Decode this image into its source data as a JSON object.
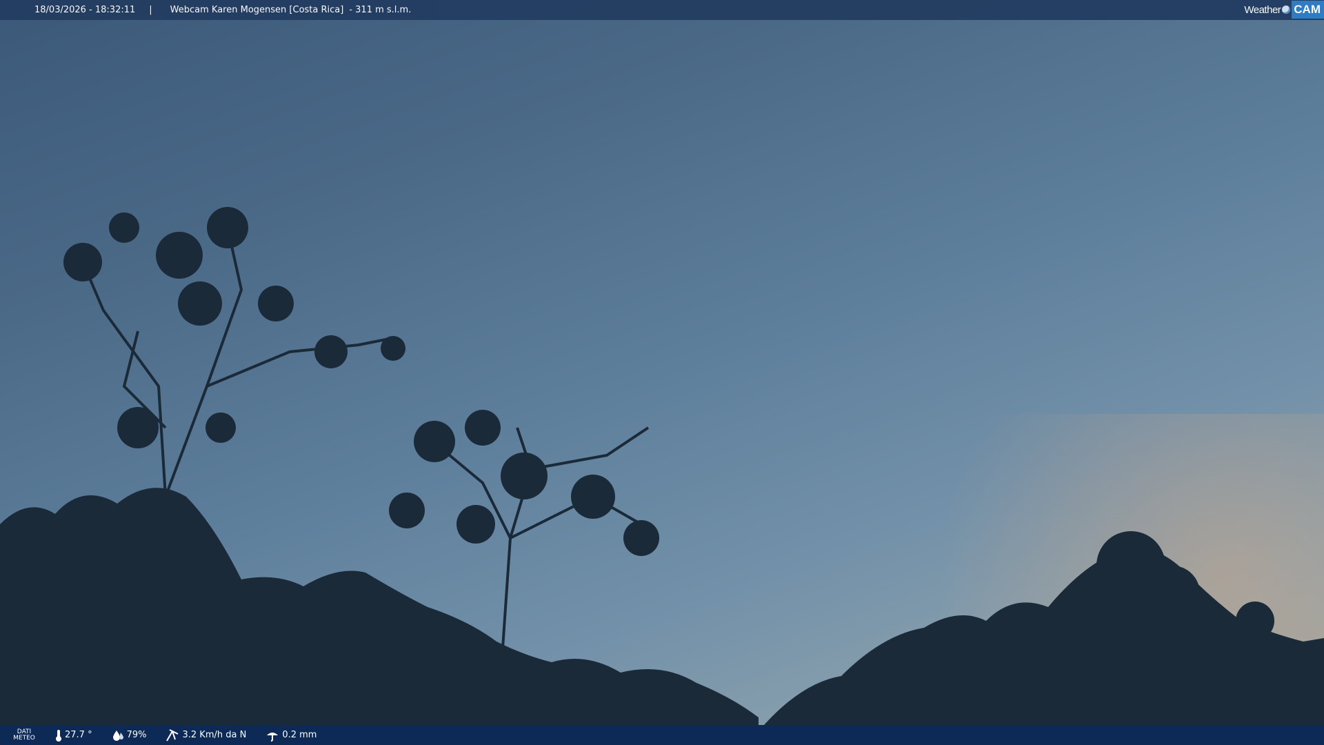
{
  "header": {
    "datetime": "18/03/2026 - 18:32:11",
    "separator": "|",
    "camera_title": "Webcam Karen Mogensen [Costa Rica]",
    "elevation": "- 311 m s.l.m.",
    "brand_weather": "Weather",
    "brand_cam": "CAM"
  },
  "weather_bar": {
    "label_line1": "DATI",
    "label_line2": "METEO",
    "temperature": "27.7 °",
    "humidity": "79%",
    "wind": "3.2 Km/h da N",
    "rain": "0.2 mm",
    "icons": [
      "thermometer-icon",
      "humidity-icon",
      "wind-icon",
      "rain-gauge-icon"
    ]
  },
  "colors": {
    "top_bar": "#233d62",
    "bottom_bar": "#0c2a55",
    "brand_accent": "#2f7dc6",
    "sky_top": "#3b5878",
    "sky_horizon": "#a7a99e",
    "foliage": "#152331"
  }
}
